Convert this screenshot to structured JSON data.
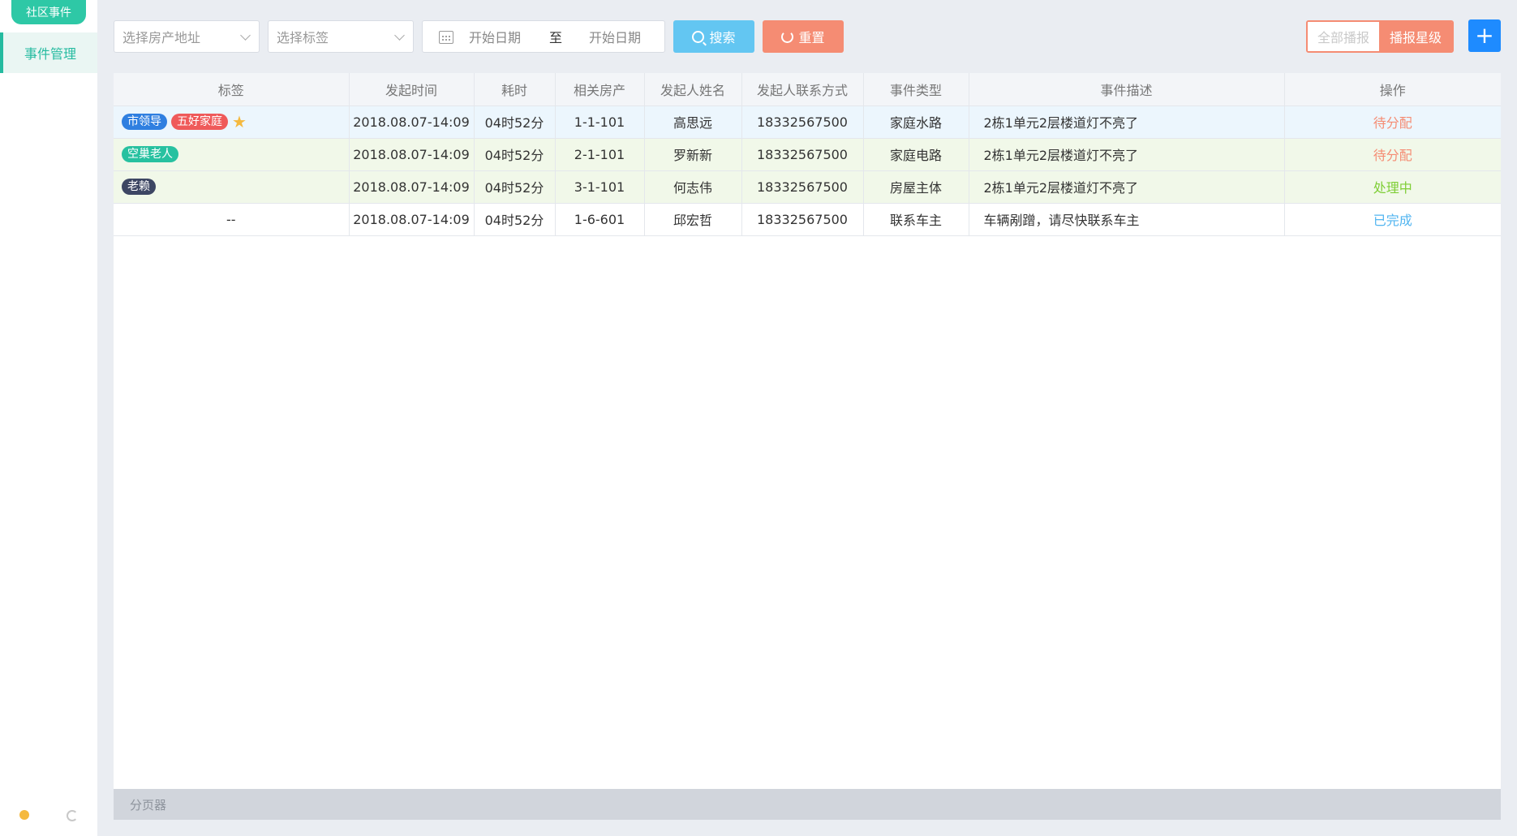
{
  "sidebar": {
    "tag_label": "社区事件",
    "active_item": "事件管理"
  },
  "toolbar": {
    "address_placeholder": "选择房产地址",
    "label_placeholder": "选择标签",
    "date_start": "开始日期",
    "date_sep": "至",
    "date_end": "开始日期",
    "search_label": "搜索",
    "reset_label": "重置",
    "seg_all": "全部播报",
    "seg_star": "播报星级",
    "add_label": "+"
  },
  "table": {
    "headers": [
      "标签",
      "发起时间",
      "耗时",
      "相关房产",
      "发起人姓名",
      "发起人联系方式",
      "事件类型",
      "事件描述",
      "操作"
    ],
    "rows": [
      {
        "tags": [
          {
            "text": "市领导",
            "color": "#2f7fe0"
          },
          {
            "text": "五好家庭",
            "color": "#ef5a5a"
          }
        ],
        "star": "★",
        "time": "2018.08.07-14:09",
        "duration": "04时52分",
        "property": "1-1-101",
        "name": "高思远",
        "phone": "18332567500",
        "type": "家庭水路",
        "desc": "2栋1单元2层楼道灯不亮了",
        "status": "待分配"
      },
      {
        "tags": [
          {
            "text": "空巢老人",
            "color": "#27c1a0"
          }
        ],
        "time": "2018.08.07-14:09",
        "duration": "04时52分",
        "property": "2-1-101",
        "name": "罗新新",
        "phone": "18332567500",
        "type": "家庭电路",
        "desc": "2栋1单元2层楼道灯不亮了",
        "status": "待分配"
      },
      {
        "tags": [
          {
            "text": "老赖",
            "color": "#3d4663"
          }
        ],
        "time": "2018.08.07-14:09",
        "duration": "04时52分",
        "property": "3-1-101",
        "name": "何志伟",
        "phone": "18332567500",
        "type": "房屋主体",
        "desc": "2栋1单元2层楼道灯不亮了",
        "status": "处理中"
      },
      {
        "tags_text": "--",
        "time": "2018.08.07-14:09",
        "duration": "04时52分",
        "property": "1-6-601",
        "name": "邱宏哲",
        "phone": "18332567500",
        "type": "联系车主",
        "desc": "车辆剐蹭，请尽快联系车主",
        "status": "已完成"
      }
    ]
  },
  "pager": {
    "label": "分页器"
  }
}
